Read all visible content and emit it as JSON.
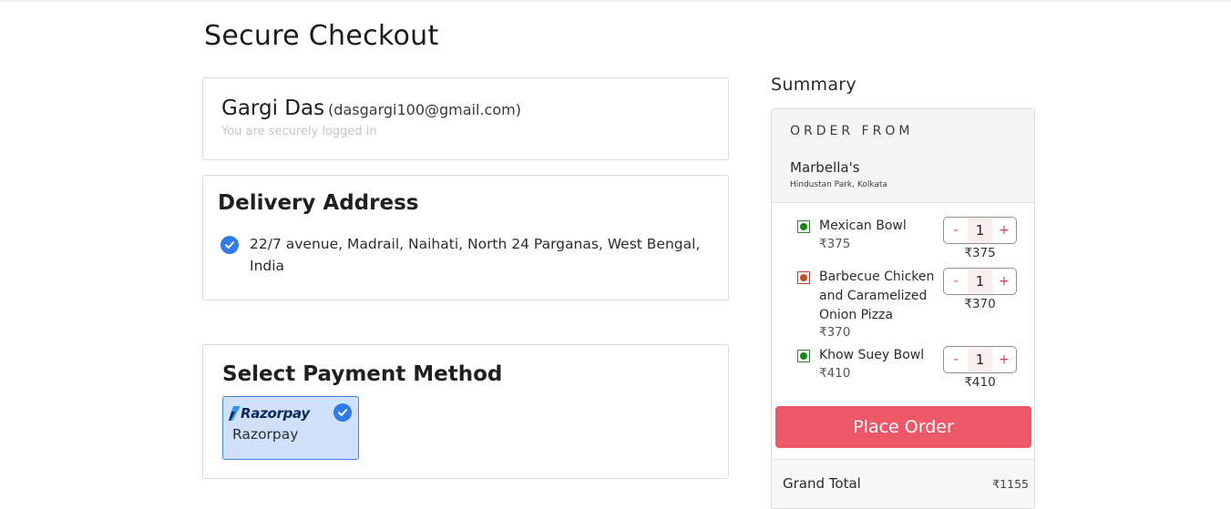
{
  "page": {
    "title": "Secure Checkout"
  },
  "user": {
    "name": "Gargi Das",
    "email": "(dasgargi100@gmail.com)",
    "login_note": "You are securely logged in"
  },
  "address": {
    "heading": "Delivery Address",
    "text": "22/7 avenue, Madrail, Naihati, North 24 Parganas, West Bengal, India"
  },
  "payment": {
    "heading": "Select Payment Method",
    "option": {
      "logo_text": "Razorpay",
      "label": "Razorpay",
      "selected": true
    }
  },
  "summary": {
    "title": "Summary",
    "order_from_label": "ORDER FROM",
    "restaurant": "Marbella's",
    "location": "Hindustan Park, Kolkata",
    "items": [
      {
        "name": "Mexican Bowl",
        "price": "₹375",
        "qty": "1",
        "total": "₹375",
        "veg": true
      },
      {
        "name": "Barbecue Chicken and Caramelized Onion Pizza",
        "price": "₹370",
        "qty": "1",
        "total": "₹370",
        "veg": false
      },
      {
        "name": "Khow Suey Bowl",
        "price": "₹410",
        "qty": "1",
        "total": "₹410",
        "veg": true
      }
    ],
    "minus": "-",
    "plus": "+",
    "place_order_label": "Place Order",
    "grand_total_label": "Grand Total",
    "grand_total_value": "₹1155"
  },
  "colors": {
    "accent": "#ec5867",
    "check": "#2f7ce6",
    "selected_bg": "#cfe1fb",
    "veg": "#0f8a0f",
    "nonveg": "#c84a1f"
  }
}
